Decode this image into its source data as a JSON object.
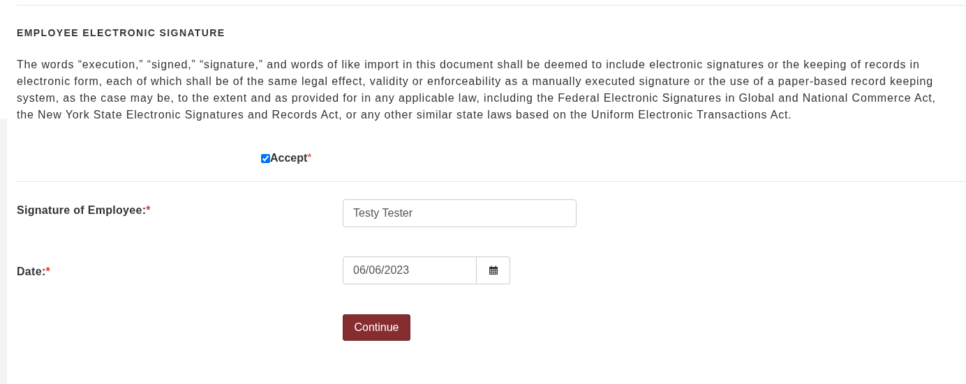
{
  "section": {
    "title": "EMPLOYEE ELECTRONIC SIGNATURE",
    "body": "The words “execution,” “signed,” “signature,” and words of like import in this document shall be deemed to include electronic signatures or the keeping of records in electronic form, each of which shall be of the same legal effect, validity or enforceability as a manually executed signature or the use of a paper-based record keeping system, as the case may be, to the extent and as provided for in any applicable law, including the Federal Electronic Signatures in Global and National Commerce Act, the New York State Electronic Signatures and Records Act, or any other similar state laws based on the Uniform Electronic Transactions Act."
  },
  "accept": {
    "label": "Accept",
    "checked": true,
    "required_mark": "*"
  },
  "fields": [
    {
      "kind": "text",
      "label": "Signature of Employee:",
      "required_mark": "*",
      "value": "Testy Tester"
    },
    {
      "kind": "date",
      "label": "Date:",
      "required_mark": "*",
      "value": "06/06/2023"
    }
  ],
  "button": "Continue"
}
